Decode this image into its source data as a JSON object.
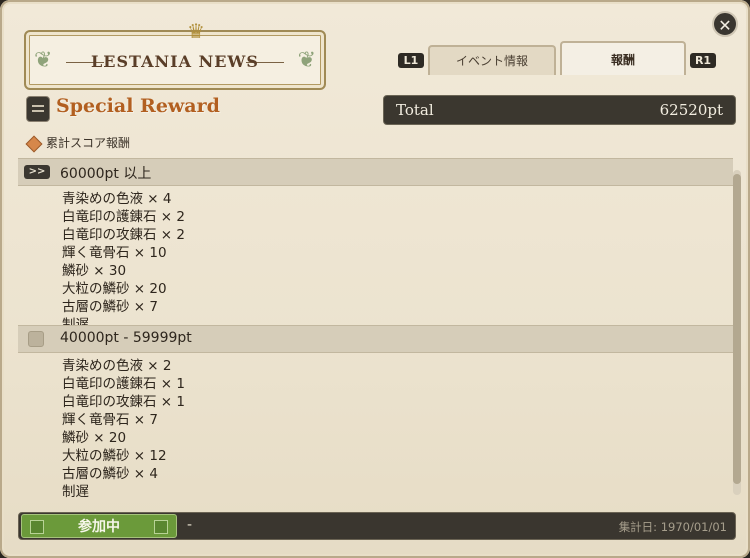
{
  "window": {
    "close_label": "✕"
  },
  "logo": {
    "title": "LESTANIA NEWS"
  },
  "tabs": {
    "left_key": "L1",
    "right_key": "R1",
    "items": [
      {
        "label": "イベント情報"
      },
      {
        "label": "報酬"
      }
    ]
  },
  "section": {
    "title": "Special Reward"
  },
  "total": {
    "label": "Total",
    "value": "62520pt"
  },
  "cumulative_label": "累計スコア報酬",
  "tiers": [
    {
      "badge": ">>",
      "range": "60000pt 以上",
      "items": [
        "青染めの色液 × 4",
        "白竜印の護錬石 × 2",
        "白竜印の攻錬石 × 2",
        "輝く竜骨石 × 10",
        "鱗砂 × 30",
        "大粒の鱗砂 × 20",
        "古層の鱗砂 × 7",
        "制遅"
      ]
    },
    {
      "badge": "",
      "range": "40000pt - 59999pt",
      "items": [
        "青染めの色液 × 2",
        "白竜印の護錬石 × 1",
        "白竜印の攻錬石 × 1",
        "輝く竜骨石 × 7",
        "鱗砂 × 20",
        "大粒の鱗砂 × 12",
        "古層の鱗砂 × 4",
        "制遅"
      ]
    }
  ],
  "footer": {
    "join_label": "参加中",
    "status": "-",
    "date_label": "集計日: 1970/01/01"
  },
  "colors": {
    "accent": "#b25f20",
    "join": "#6b9a3a",
    "dark_bar": "#3b372f"
  }
}
